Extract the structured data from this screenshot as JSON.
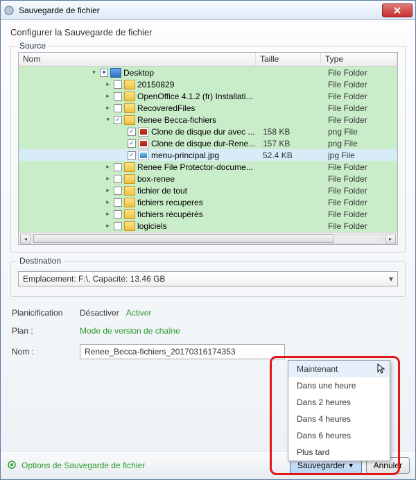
{
  "window": {
    "title": "Sauvegarde de fichier"
  },
  "page_title": "Configurer la Sauvegarde de fichier",
  "source": {
    "label": "Source",
    "columns": {
      "name": "Nom",
      "size": "Taille",
      "type": "Type"
    },
    "rows": [
      {
        "indent": 0,
        "expander": "down",
        "checkbox": "mixed",
        "icon": "desktop",
        "name": "Desktop",
        "size": "",
        "type": "File Folder"
      },
      {
        "indent": 1,
        "expander": "right",
        "checkbox": "",
        "icon": "folder",
        "name": "20150829",
        "size": "",
        "type": "File Folder"
      },
      {
        "indent": 1,
        "expander": "right",
        "checkbox": "",
        "icon": "folder",
        "name": "OpenOffice 4.1.2 (fr) Installati...",
        "size": "",
        "type": "File Folder"
      },
      {
        "indent": 1,
        "expander": "right",
        "checkbox": "",
        "icon": "folder",
        "name": "RecoveredFiles",
        "size": "",
        "type": "File Folder"
      },
      {
        "indent": 1,
        "expander": "down",
        "checkbox": "checked",
        "icon": "folder",
        "name": "Renee Becca-fichiers",
        "size": "",
        "type": "File Folder"
      },
      {
        "indent": 2,
        "expander": "",
        "checkbox": "checked",
        "icon": "png",
        "name": "Clone de disque dur avec ...",
        "size": "158 KB",
        "type": "png File"
      },
      {
        "indent": 2,
        "expander": "",
        "checkbox": "checked",
        "icon": "png",
        "name": "Clone de disque dur-Rene...",
        "size": "157 KB",
        "type": "png File"
      },
      {
        "indent": 2,
        "expander": "",
        "checkbox": "checked",
        "icon": "jpg",
        "name": "menu-principal.jpg",
        "size": "52.4 KB",
        "type": "jpg File",
        "selected": true
      },
      {
        "indent": 1,
        "expander": "right",
        "checkbox": "",
        "icon": "folder",
        "name": "Renee File Protector-docume...",
        "size": "",
        "type": "File Folder"
      },
      {
        "indent": 1,
        "expander": "right",
        "checkbox": "",
        "icon": "folder",
        "name": "box-renee",
        "size": "",
        "type": "File Folder"
      },
      {
        "indent": 1,
        "expander": "right",
        "checkbox": "",
        "icon": "folder",
        "name": "fichier de tout",
        "size": "",
        "type": "File Folder"
      },
      {
        "indent": 1,
        "expander": "right",
        "checkbox": "",
        "icon": "folder",
        "name": "fichiers recuperes",
        "size": "",
        "type": "File Folder"
      },
      {
        "indent": 1,
        "expander": "right",
        "checkbox": "",
        "icon": "folder",
        "name": "fichiers récupérés",
        "size": "",
        "type": "File Folder"
      },
      {
        "indent": 1,
        "expander": "right",
        "checkbox": "",
        "icon": "folder",
        "name": "logiciels",
        "size": "",
        "type": "File Folder"
      }
    ]
  },
  "destination": {
    "label": "Destination",
    "value": "Emplacement: F:\\, Capacité: 13.46 GB"
  },
  "planning": {
    "label": "Planicification",
    "disable": "Désactiver",
    "enable": "Activer",
    "plan_label": "Plan :",
    "plan_value": "Mode de version de chaîne",
    "name_label": "Nom :",
    "name_value": "Renee_Becca-fichiers_20170316174353"
  },
  "footer": {
    "options": "Options de Sauvegarde de fichier",
    "save": "Sauvegarder",
    "cancel": "Annuler"
  },
  "menu": {
    "items": [
      "Maintenant",
      "Dans une heure",
      "Dans 2 heures",
      "Dans 4 heures",
      "Dans 6 heures",
      "Plus tard"
    ]
  }
}
